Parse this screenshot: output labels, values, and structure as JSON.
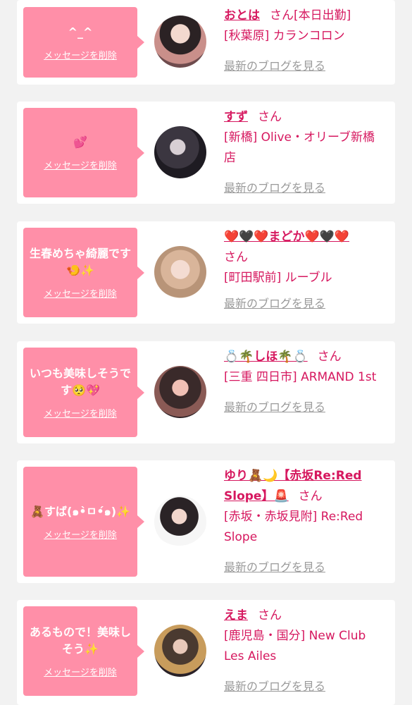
{
  "delete_label": "メッセージを削除",
  "blog_label": "最新のブログを見る",
  "suffix": "さん",
  "entries": [
    {
      "message": "^_^",
      "name": "おとは",
      "suffix_inline": "さん[本日出勤]",
      "shop": "[秋葉原] カランコロン"
    },
    {
      "message": "💕",
      "name": "すず",
      "shop": "[新橋] Olive・オリーブ新橋店"
    },
    {
      "message": "生春めちゃ綺麗です🍤✨",
      "name": "❤️🖤❤️まどか❤️🖤❤️",
      "shop": "[町田駅前] ルーブル"
    },
    {
      "message": "いつも美味しそうです🥺💖",
      "name": "💍🌴しほ🌴💍",
      "shop": "[三重 四日市] ARMAND 1st"
    },
    {
      "message": "🧸すば(๑•̀ㅁ•́๑)✨",
      "name": "ゆり🧸🌙【赤坂Re:Red Slope】🚨",
      "shop": "[赤坂・赤坂見附] Re:Red Slope"
    },
    {
      "message": "あるもので！美味しそう✨",
      "name": "えま",
      "shop": "[鹿児島・国分] New Club Les Ailes"
    }
  ]
}
